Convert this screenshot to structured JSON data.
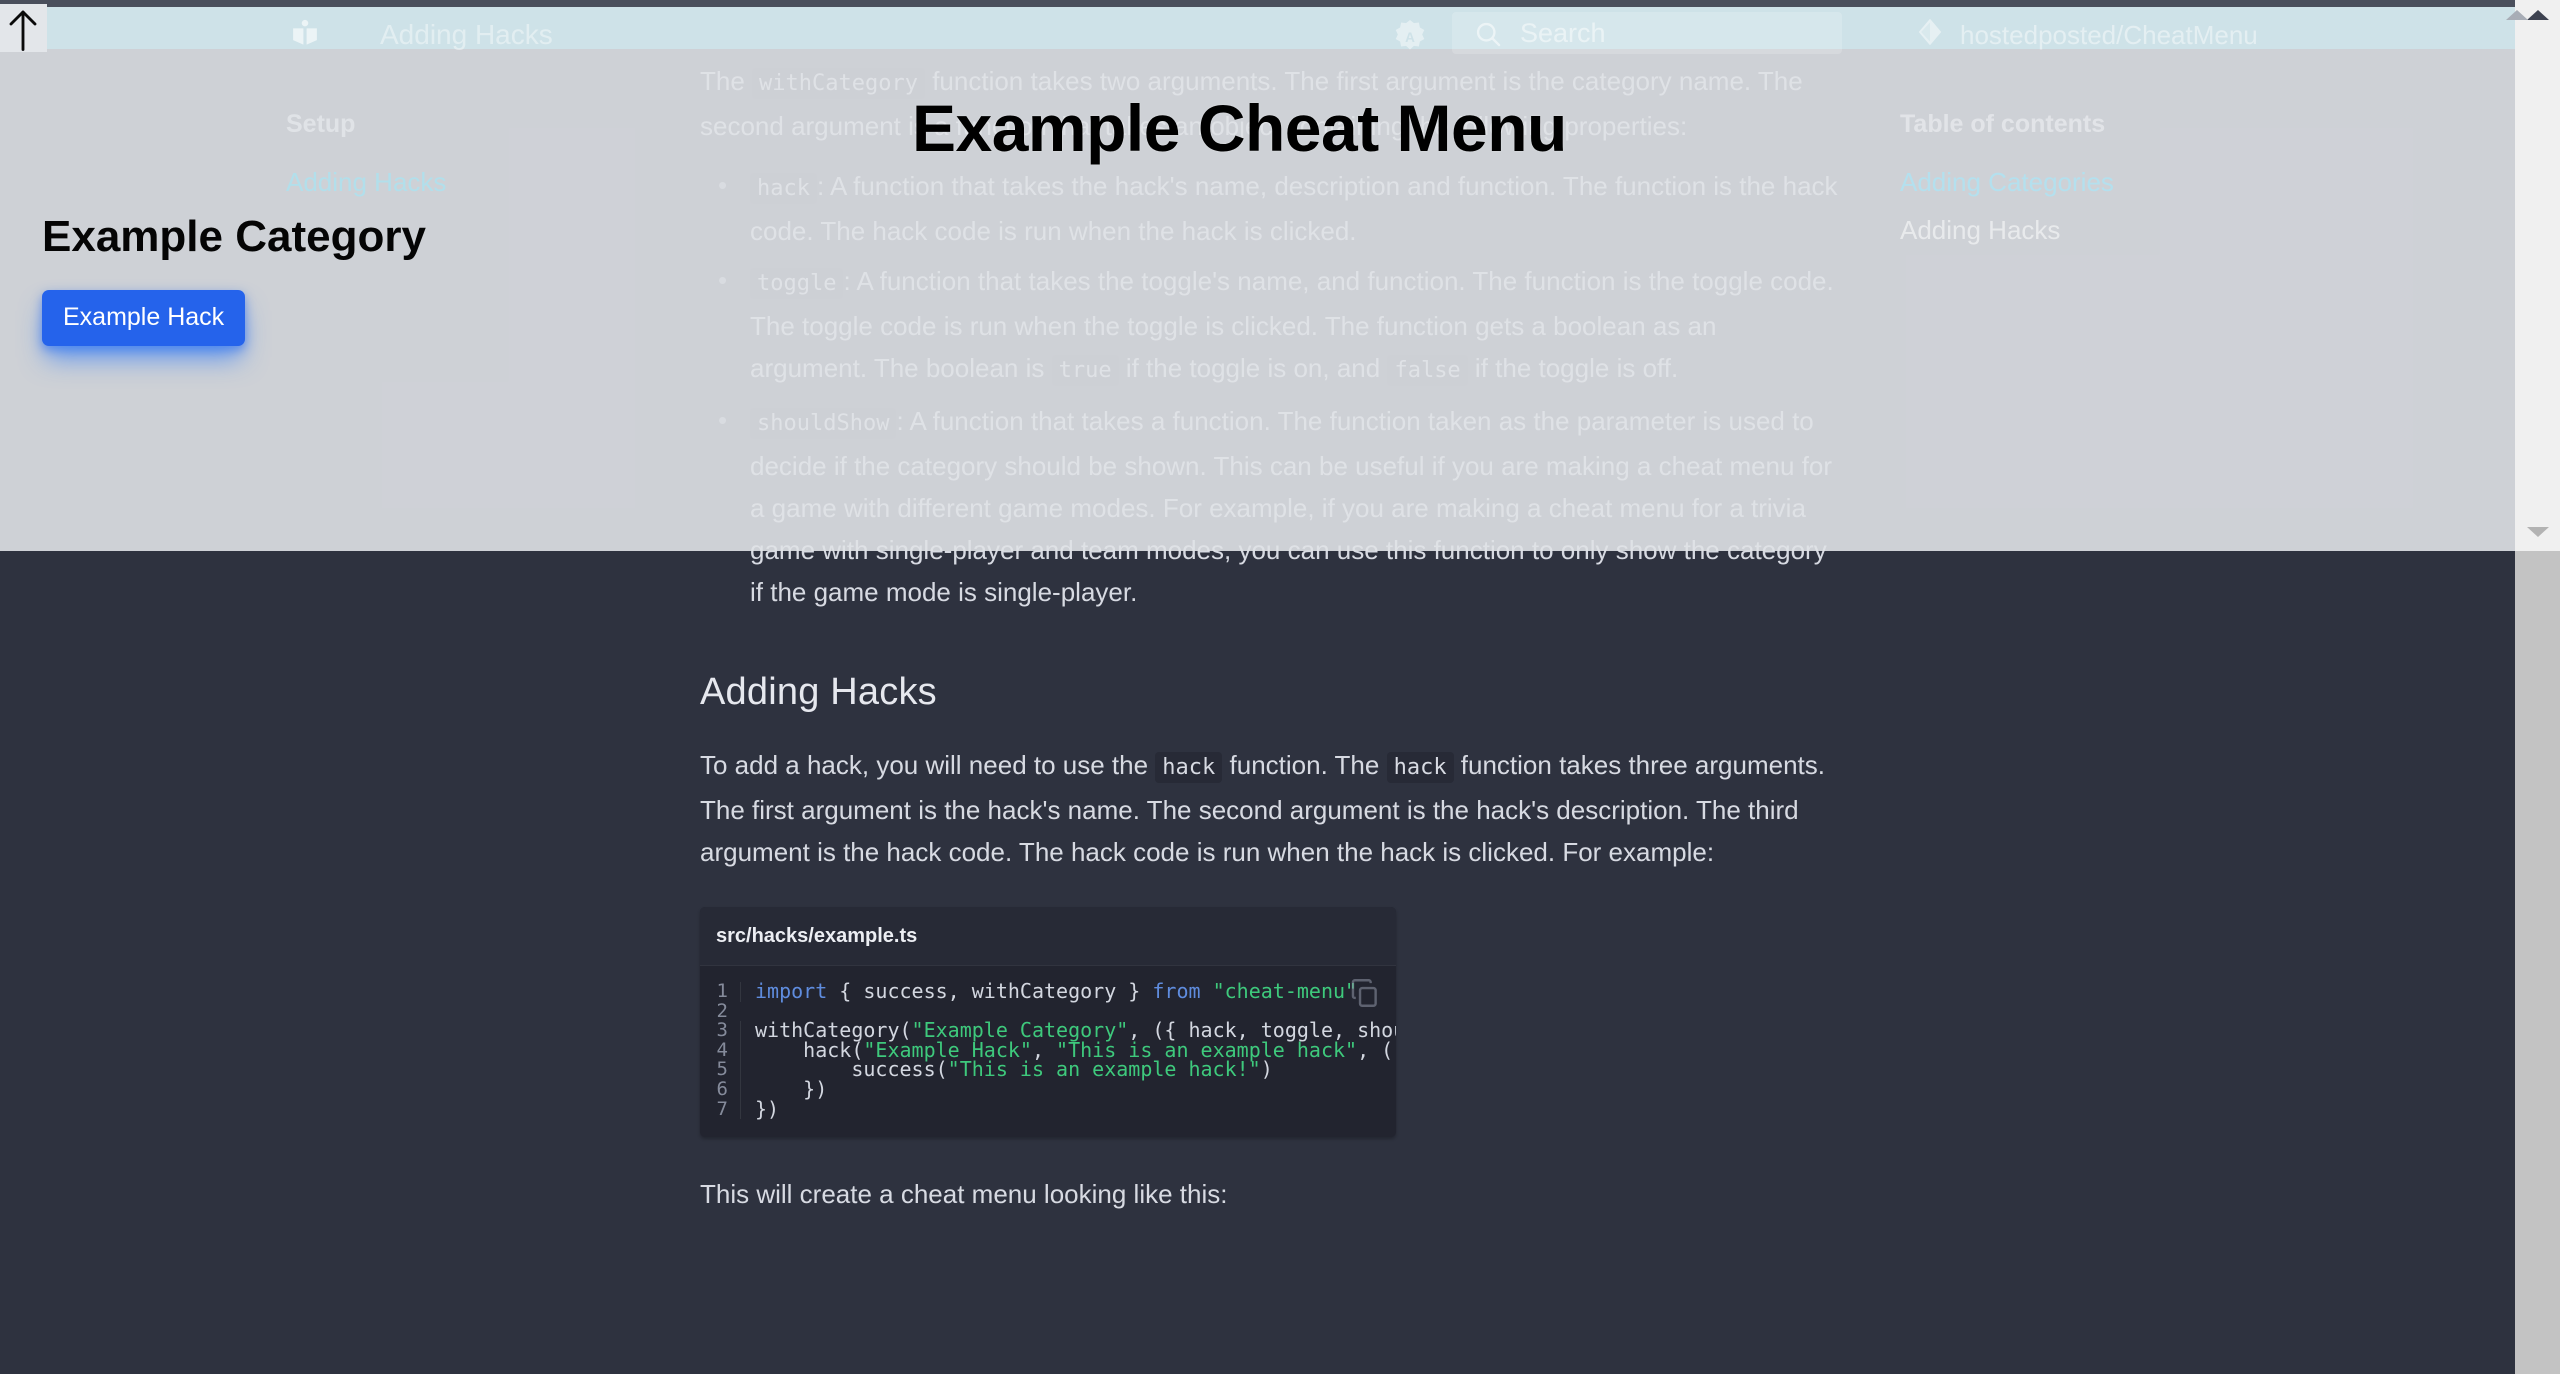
{
  "header": {
    "logo_icon": "book-open-icon",
    "title": "Adding Hacks",
    "theme_toggle_icon": "brightness-badge-icon",
    "search_icon": "search-icon",
    "search_placeholder": "Search",
    "search_value": "",
    "repo_icon": "git-diamond-icon",
    "repo_label": "hostedposted/CheatMenu"
  },
  "sidebar": {
    "heading": "Setup",
    "items": [
      {
        "label": "Adding Hacks",
        "active": true
      }
    ]
  },
  "toc": {
    "heading": "Table of contents",
    "items": [
      {
        "label": "Adding Categories",
        "active": true
      },
      {
        "label": "Adding Hacks",
        "active": false
      }
    ]
  },
  "cheat_menu": {
    "title": "Example Cheat Menu",
    "category": "Example Category",
    "hack_button": "Example Hack",
    "button_color": "#2563eb"
  },
  "content": {
    "intro_prefix": "The ",
    "intro_code": "withCategory",
    "intro_suffix": " function takes two arguments. The first argument is the category name. The second argument is a function that takes an object containing the following properties:",
    "bullets": [
      {
        "code": "hack",
        "text": ": A function that takes the hack's name, description and function. The function is the hack code. The hack code is run when the hack is clicked."
      },
      {
        "code": "toggle",
        "text_1": ": A function that takes the toggle's name, and function. The function is the toggle code. The toggle code is run when the toggle is clicked. The function gets a boolean as an argument. The boolean is ",
        "code_2": "true",
        "text_2": " if the toggle is on, and ",
        "code_3": "false",
        "text_3": " if the toggle is off."
      },
      {
        "code": "shouldShow",
        "text": ": A function that takes a function. The function taken as the parameter is used to decide if the category should be shown. This can be useful if you are making a cheat menu for a game with different game modes. For example, if you are making a cheat menu for a trivia game with single-player and team modes, you can use this function to only show the category if the game mode is single-player."
      }
    ],
    "section_heading": "Adding Hacks",
    "para_1_a": "To add a hack, you will need to use the ",
    "para_1_code_1": "hack",
    "para_1_b": " function. The ",
    "para_1_code_2": "hack",
    "para_1_c": " function takes three arguments. The first argument is the hack's name. The second argument is the hack's description. The third argument is the hack code. The hack code is run when the hack is clicked. For example:",
    "closing_para": "This will create a cheat menu looking like this:"
  },
  "code_block": {
    "filename": "src/hacks/example.ts",
    "copy_icon": "copy-icon",
    "lines": [
      {
        "n": "1",
        "segments": [
          {
            "t": "import",
            "c": "kw"
          },
          {
            "t": " { success, withCategory } ",
            "c": "pl"
          },
          {
            "t": "from",
            "c": "kw"
          },
          {
            "t": " ",
            "c": "pl"
          },
          {
            "t": "\"cheat-menu\"",
            "c": "str"
          }
        ]
      },
      {
        "n": "2",
        "segments": [
          {
            "t": "",
            "c": "pl"
          }
        ]
      },
      {
        "n": "3",
        "segments": [
          {
            "t": "withCategory(",
            "c": "pl"
          },
          {
            "t": "\"Example Category\"",
            "c": "str"
          },
          {
            "t": ", ({ hack, toggle, shouldShow }) => {",
            "c": "pl"
          }
        ]
      },
      {
        "n": "4",
        "segments": [
          {
            "t": "    hack(",
            "c": "pl"
          },
          {
            "t": "\"Example Hack\"",
            "c": "str"
          },
          {
            "t": ", ",
            "c": "pl"
          },
          {
            "t": "\"This is an example hack\"",
            "c": "str"
          },
          {
            "t": ", () => {",
            "c": "pl"
          }
        ]
      },
      {
        "n": "5",
        "segments": [
          {
            "t": "        success(",
            "c": "pl"
          },
          {
            "t": "\"This is an example hack!\"",
            "c": "str"
          },
          {
            "t": ")",
            "c": "pl"
          }
        ]
      },
      {
        "n": "6",
        "segments": [
          {
            "t": "    })",
            "c": "pl"
          }
        ]
      },
      {
        "n": "7",
        "segments": [
          {
            "t": "})",
            "c": "pl"
          }
        ]
      }
    ]
  },
  "scrollbar": {
    "up_arrow_icon": "scroll-up-arrow-icon",
    "down_arrow_icon": "scroll-down-arrow-icon"
  },
  "cursor": {
    "icon": "up-arrow-cursor-icon"
  },
  "colors": {
    "page_bg": "#2e323f",
    "code_bg": "#22242f",
    "header_bg": "#cee2e8",
    "accent_blue": "#2563eb",
    "link_cyan": "#a9e4f2",
    "string_green": "#3ec97c",
    "keyword_blue": "#5f8cde"
  }
}
